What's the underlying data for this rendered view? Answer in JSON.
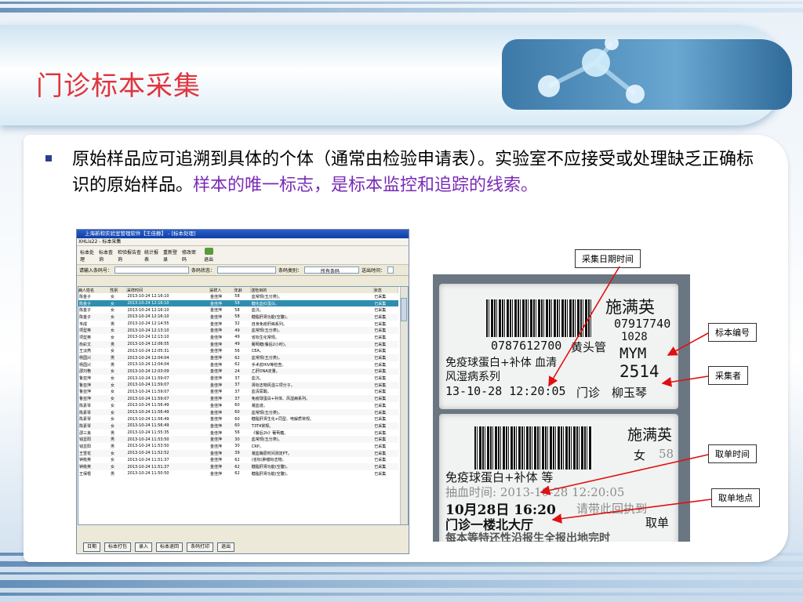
{
  "slide": {
    "title": "门诊标本采集",
    "body_plain": "原始样品应可追溯到具体的个体（通常由检验申请表）。实验室不应接受或处理缺乏正确标识的原始样品。",
    "body_highlight": "样本的唯一标志，是标本监控和追踪的线索。",
    "colors": {
      "title": "#e0353d",
      "highlight": "#7a2bb6",
      "bullet": "#2a3d8f"
    }
  },
  "software": {
    "window_title": "上海新和实验室管理软件【王佳静】 - [标本处理]",
    "menu": "XHLis22 - 标本采集",
    "toolbar": [
      "标本处理",
      "标本查询",
      "检验报告查询",
      "统计报表",
      "重新登录",
      "修改密码",
      "退出"
    ],
    "filter": {
      "input_label": "请输入条码号：",
      "status_label": "条码状态：",
      "type_label": "条码类别：",
      "type_value": "所有条码",
      "time_label": "送出时间："
    },
    "columns": [
      "病人姓名",
      "性别",
      "采样时间",
      "采样人",
      "年龄",
      "送检目的",
      "状态"
    ],
    "rows": [
      [
        "陈金子",
        "女",
        "2013-10-24 12:16:10",
        "金佳萍",
        "58",
        "血常规(五分类)。",
        "已采集"
      ],
      [
        "陈金子",
        "女",
        "2013-10-24 12:16:10",
        "金佳萍",
        "58",
        "糖化血红蛋白。",
        "已采集"
      ],
      [
        "陈金子",
        "女",
        "2013-10-24 12:16:10",
        "金佳萍",
        "58",
        "血沉。",
        "已采集"
      ],
      [
        "陈金子",
        "女",
        "2013-10-24 12:16:10",
        "金佳萍",
        "58",
        "糖脂肝肾功能(空腹)。",
        "已采集"
      ],
      [
        "韦成",
        "男",
        "2013-10-24 12:14:55",
        "金佳萍",
        "32",
        "自身免疫肝病系列。",
        "已采集"
      ],
      [
        "项型英",
        "女",
        "2013-10-24 12:13:10",
        "金佳萍",
        "49",
        "血常规(五分类)。",
        "已采集"
      ],
      [
        "项型英",
        "女",
        "2013-10-24 12:13:10",
        "金佳萍",
        "49",
        "省标生化常规。",
        "已采集"
      ],
      [
        "俞彩文",
        "男",
        "2013-10-24 12:06:55",
        "金佳萍",
        "49",
        "葡萄糖(餐后2小时)。",
        "已采集"
      ],
      [
        "王淡燕",
        "女",
        "2013-10-24 12:05:31",
        "金佳萍",
        "56",
        "CEA。",
        "已采集"
      ],
      [
        "杨国兴",
        "男",
        "2013-10-24 12:04:04",
        "金佳萍",
        "62",
        "血常规(五分类)。",
        "已采集"
      ],
      [
        "杨国兴",
        "男",
        "2013-10-24 12:04:04",
        "金佳萍",
        "62",
        "手术前HIV等检查。",
        "已采集"
      ],
      [
        "邵刘艳",
        "女",
        "2013-10-24 12:03:09",
        "金佳萍",
        "24",
        "乙肝DNA定量。",
        "已采集"
      ],
      [
        "鲁亚萍",
        "女",
        "2013-10-24 11:59:07",
        "金佳萍",
        "37",
        "血沉。",
        "已采集"
      ],
      [
        "鲁亚萍",
        "女",
        "2013-10-24 11:59:07",
        "金佳萍",
        "37",
        "肾标志物风湿三项分子。",
        "已采集"
      ],
      [
        "鲁亚萍",
        "女",
        "2013-10-24 11:59:07",
        "金佳萍",
        "37",
        "血清尿酸。",
        "已采集"
      ],
      [
        "鲁亚萍",
        "女",
        "2013-10-24 11:59:07",
        "金佳萍",
        "37",
        "免疫球蛋白+补体、风湿病系列。",
        "已采集"
      ],
      [
        "陈素琴",
        "女",
        "2013-10-24 11:56:49",
        "金佳萍",
        "60",
        "凝血谱。",
        "已采集"
      ],
      [
        "陈素琴",
        "女",
        "2013-10-24 11:56:49",
        "金佳萍",
        "60",
        "血常规(五分类)。",
        "已采集"
      ],
      [
        "陈素琴",
        "女",
        "2013-10-24 11:56:49",
        "金佳萍",
        "60",
        "糖脂肝肾生化+同型、电解质常规。",
        "已采集"
      ],
      [
        "陈素琴",
        "女",
        "2013-10-24 11:56:49",
        "金佳萍",
        "60",
        "T3T4常规。",
        "已采集"
      ],
      [
        "邵三良",
        "男",
        "2013-10-24 11:55:35",
        "金佳萍",
        "56",
        "《餐后2h》葡萄糖。",
        "已采集"
      ],
      [
        "钱显阳",
        "男",
        "2013-10-24 11:53:50",
        "金佳萍",
        "30",
        "血常规(五分类)。",
        "已采集"
      ],
      [
        "钱显阳",
        "男",
        "2013-10-24 11:53:50",
        "金佳萍",
        "30",
        "CRP。",
        "已采集"
      ],
      [
        "王雪花",
        "女",
        "2013-10-24 11:52:52",
        "金佳萍",
        "39",
        "凝血酶原时间测定PT。",
        "已采集"
      ],
      [
        "钟桃英",
        "女",
        "2013-10-24 11:51:37",
        "金佳萍",
        "62",
        "(省标)肿瘤标志物。",
        "已采集"
      ],
      [
        "钟桃英",
        "女",
        "2013-10-24 11:51:37",
        "金佳萍",
        "62",
        "糖脂肝肾功能(空腹)。",
        "已采集"
      ],
      [
        "王保根",
        "男",
        "2013-10-24 11:50:50",
        "金佳萍",
        "62",
        "糖脂肝肾功能(空腹)。",
        "已采集"
      ]
    ],
    "selected_row": 1,
    "buttons": [
      "日期",
      "标本打包",
      "录入",
      "标本退回",
      "条码打印",
      "退出"
    ]
  },
  "label_top": {
    "name": "施满英",
    "barcode_number": "0787612700",
    "tube": "黄头管",
    "id": "07917740",
    "code1": "1028",
    "code2": "MYM",
    "specimen_no": "2514",
    "tests1": "免疫球蛋白+补体 血清",
    "tests2": "风湿病系列",
    "datetime": "13-10-28 12:20:05",
    "dept": "门诊",
    "collector": "柳玉琴"
  },
  "label_bottom": {
    "name": "施满英",
    "sex": "女",
    "age": "58",
    "tests": "免疫球蛋白+补体   等",
    "draw_time": "抽血时间: 2013-10-28 12:20:05",
    "pickup_time": "10月28日 16:20",
    "pickup_note": "请带此回执到",
    "pickup_place": "门诊一楼北大厅",
    "pickup_word": "取单",
    "footer": "每本等特还性沿报生全报出地完时"
  },
  "callouts": {
    "date": "采集日期时间",
    "number": "标本编号",
    "collector": "采集者",
    "pickup_time": "取单时间",
    "pickup_place": "取单地点"
  }
}
